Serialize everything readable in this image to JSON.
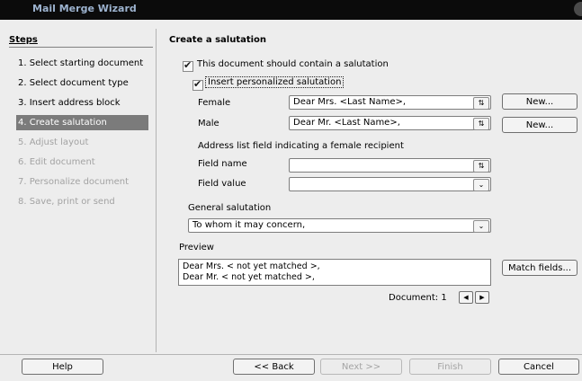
{
  "window": {
    "title": "Mail Merge Wizard"
  },
  "steps": {
    "title": "Steps",
    "items": [
      {
        "label": "1. Select starting document",
        "state": "done"
      },
      {
        "label": "2. Select document type",
        "state": "done"
      },
      {
        "label": "3. Insert address block",
        "state": "done"
      },
      {
        "label": "4. Create salutation",
        "state": "current"
      },
      {
        "label": "5. Adjust layout",
        "state": "todo"
      },
      {
        "label": "6. Edit document",
        "state": "todo"
      },
      {
        "label": "7. Personalize document",
        "state": "todo"
      },
      {
        "label": "8. Save, print or send",
        "state": "todo"
      }
    ]
  },
  "main": {
    "title": "Create a salutation",
    "contain_salutation": {
      "label": "This document should contain a salutation",
      "checked": true
    },
    "personalized": {
      "label": "Insert personalized salutation",
      "checked": true
    },
    "female": {
      "label": "Female",
      "value": "Dear Mrs. <Last Name>,",
      "button": "New..."
    },
    "male": {
      "label": "Male",
      "value": "Dear Mr. <Last Name>,",
      "button": "New..."
    },
    "address_field_heading": "Address list field indicating a female recipient",
    "field_name": {
      "label": "Field name",
      "value": ""
    },
    "field_value": {
      "label": "Field value",
      "value": ""
    },
    "general": {
      "label": "General salutation",
      "value": "To whom it may concern,"
    },
    "preview": {
      "label": "Preview",
      "lines": [
        "Dear Mrs. < not yet matched >,",
        "Dear Mr. < not yet matched >,"
      ],
      "match_button": "Match fields..."
    },
    "document_nav": {
      "label": "Document: 1"
    }
  },
  "footer": {
    "help": "Help",
    "back": "<< Back",
    "next": "Next >>",
    "finish": "Finish",
    "cancel": "Cancel"
  }
}
